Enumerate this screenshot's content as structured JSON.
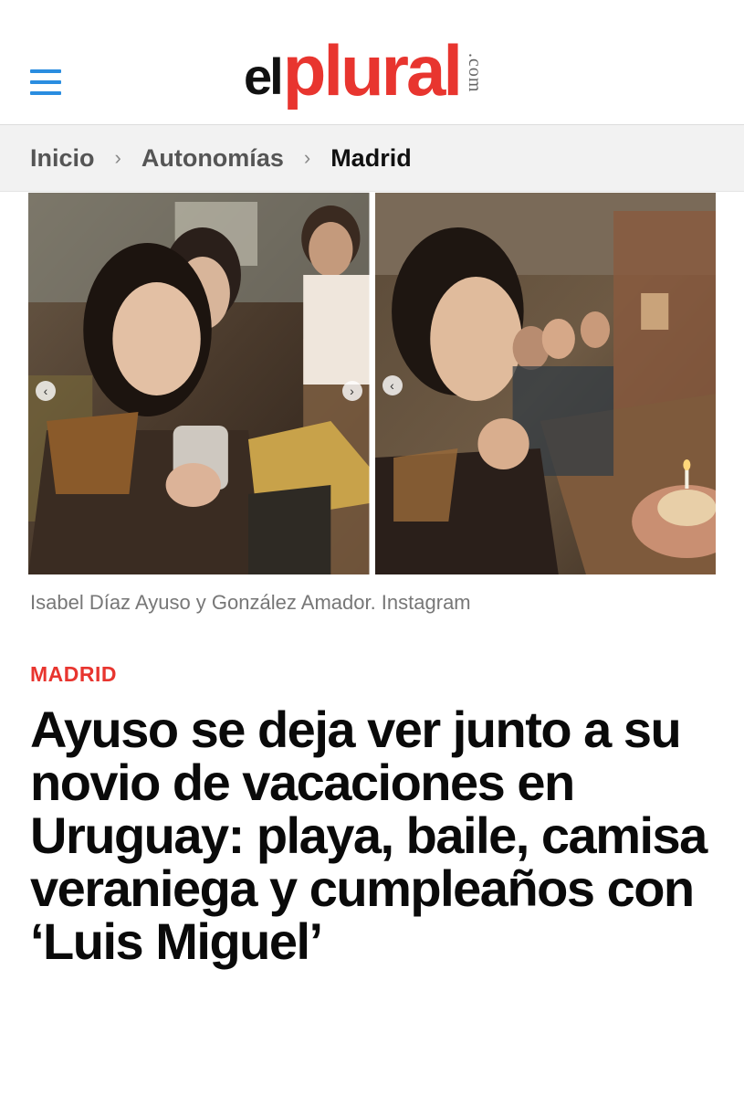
{
  "header": {
    "logo_el": "el",
    "logo_plural": "plural",
    "logo_com": ".com"
  },
  "breadcrumb": {
    "items": [
      "Inicio",
      "Autonomías",
      "Madrid"
    ],
    "separator": "›"
  },
  "photos": {
    "prev_arrow": "‹",
    "next_arrow": "›"
  },
  "caption": "Isabel Díaz Ayuso y González Amador. Instagram",
  "section": "MADRID",
  "headline": "Ayuso se deja ver junto a su novio de vacaciones en Uruguay: playa, baile, camisa veraniega y cumpleaños con ‘Luis Miguel’",
  "colors": {
    "brand_red": "#e8352f",
    "menu_blue": "#2a8de0"
  }
}
